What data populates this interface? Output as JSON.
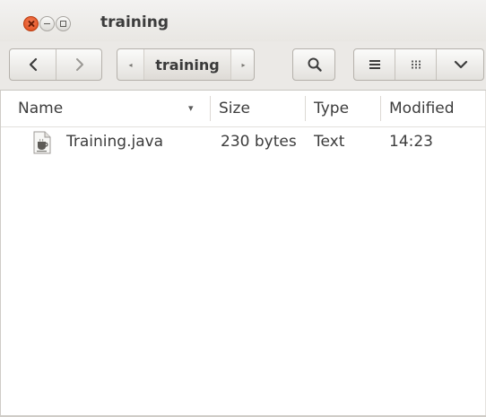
{
  "window": {
    "title": "training"
  },
  "toolbar": {
    "back_icon": "chevron-left-icon",
    "forward_icon": "chevron-right-icon",
    "path_crumb": "training",
    "search_icon": "search-icon",
    "list_view_icon": "list-view-icon",
    "grid_view_icon": "grid-view-icon",
    "menu_icon": "chevron-down-icon"
  },
  "columns": {
    "name": "Name",
    "size": "Size",
    "type": "Type",
    "modified": "Modified",
    "sort_indicator": "▾"
  },
  "files": [
    {
      "name": "Training.java",
      "size": "230 bytes",
      "type": "Text",
      "modified": "14:23",
      "icon": "java-file-icon"
    }
  ],
  "colors": {
    "close_button": "#df4a16",
    "titlebar": "#efeeec",
    "text": "#3c3c3c"
  }
}
